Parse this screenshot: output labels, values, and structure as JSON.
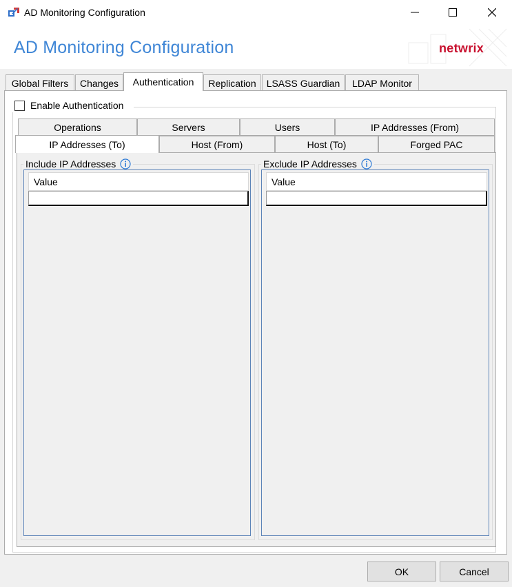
{
  "window": {
    "title": "AD Monitoring Configuration",
    "controls": [
      "minimize-icon",
      "maximize-icon",
      "close-icon"
    ]
  },
  "header": {
    "title": "AD Monitoring Configuration",
    "brand": "netwrix",
    "title_color": "#3f86d6",
    "brand_color": "#c8102e"
  },
  "main_tabs": [
    {
      "label": "Global Filters",
      "active": false
    },
    {
      "label": "Changes",
      "active": false
    },
    {
      "label": "Authentication",
      "active": true
    },
    {
      "label": "Replication",
      "active": false
    },
    {
      "label": "LSASS Guardian",
      "active": false
    },
    {
      "label": "LDAP Monitor",
      "active": false
    }
  ],
  "authentication": {
    "enable_label": "Enable Authentication",
    "enabled": false,
    "sub_tabs_row1": [
      {
        "label": "Operations"
      },
      {
        "label": "Servers"
      },
      {
        "label": "Users"
      },
      {
        "label": "IP Addresses (From)"
      }
    ],
    "sub_tabs_row2": [
      {
        "label": "IP Addresses (To)",
        "active": true
      },
      {
        "label": "Host (From)"
      },
      {
        "label": "Host (To)"
      },
      {
        "label": "Forged PAC"
      }
    ],
    "include": {
      "legend": "Include IP Addresses",
      "column": "Value",
      "rows": [
        ""
      ]
    },
    "exclude": {
      "legend": "Exclude IP Addresses",
      "column": "Value",
      "rows": [
        ""
      ]
    }
  },
  "buttons": {
    "ok": "OK",
    "cancel": "Cancel"
  }
}
